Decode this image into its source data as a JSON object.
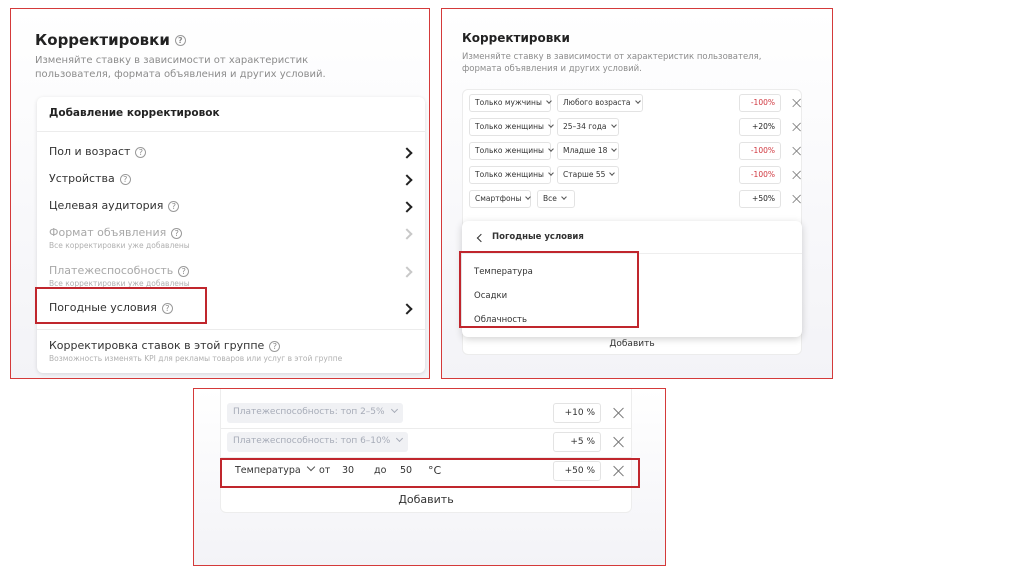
{
  "panel1": {
    "title": "Корректировки",
    "description": "Изменяйте ставку в зависимости от характеристик пользователя, формата объявления и других условий.",
    "card_title": "Добавление корректировок",
    "items": [
      {
        "label": "Пол и возраст",
        "sub": "",
        "enabled": true
      },
      {
        "label": "Устройства",
        "sub": "",
        "enabled": true
      },
      {
        "label": "Целевая аудитория",
        "sub": "",
        "enabled": true
      },
      {
        "label": "Формат объявления",
        "sub": "Все корректировки уже добавлены",
        "enabled": false
      },
      {
        "label": "Платежеспособность",
        "sub": "Все корректировки уже добавлены",
        "enabled": false
      },
      {
        "label": "Погодные условия",
        "sub": "",
        "enabled": true
      },
      {
        "label": "Корректировка ставок в этой группе",
        "sub": "Возможность изменять KPI для рекламы товаров или услуг в этой группе",
        "enabled": true
      }
    ]
  },
  "panel2": {
    "title": "Корректировки",
    "description": "Изменяйте ставку в зависимости от характеристик пользователя, формата объявления и других условий.",
    "rows": [
      {
        "a": "Только мужчины",
        "b": "Любого возраста",
        "pct": "-100%"
      },
      {
        "a": "Только женщины",
        "b": "25–34 года",
        "pct": "+20%"
      },
      {
        "a": "Только женщины",
        "b": "Младше 18",
        "pct": "-100%"
      },
      {
        "a": "Только женщины",
        "b": "Старше 55",
        "pct": "-100%"
      },
      {
        "a": "Смартфоны",
        "b": "Все",
        "pct": "+50%"
      }
    ],
    "dropdown": {
      "header": "Погодные условия",
      "items": [
        "Температура",
        "Осадки",
        "Облачность"
      ]
    },
    "add_label": "Добавить"
  },
  "panel3": {
    "rows": [
      {
        "label": "Платежеспособность: топ 2–5%",
        "pct": "+10 %"
      },
      {
        "label": "Платежеспособность: топ 6–10%",
        "pct": "+5 %"
      }
    ],
    "temp_row": {
      "label": "Температура",
      "from_label": "от",
      "from": "30",
      "to_label": "до",
      "to": "50",
      "unit": "°С",
      "pct": "+50 %"
    },
    "add_label": "Добавить"
  },
  "colors": {
    "highlight": "#c0262d",
    "negative": "#d0373f"
  }
}
